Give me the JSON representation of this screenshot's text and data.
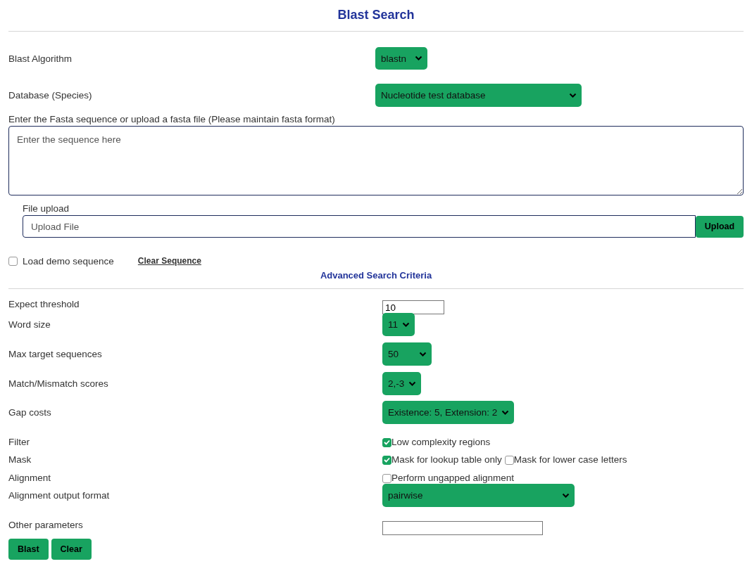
{
  "title": "Blast Search",
  "top_rows": [
    {
      "label": "Blast Algorithm",
      "value": "blastn"
    },
    {
      "label": "Database (Species)",
      "value": "Nucleotide test database"
    }
  ],
  "sequence": {
    "label": "Enter the Fasta sequence or upload a fasta file (Please maintain fasta format)",
    "placeholder": "Enter the sequence here"
  },
  "file_upload": {
    "label": "File upload",
    "placeholder": "Upload File",
    "button": "Upload"
  },
  "demo": {
    "label": "Load demo sequence",
    "checked": false
  },
  "clear_sequence": "Clear Sequence",
  "advanced_title": "Advanced Search Criteria",
  "advanced_rows": [
    {
      "label": "Expect threshold",
      "kind": "text",
      "value": "10"
    },
    {
      "label": "Word size",
      "kind": "select",
      "value": "11"
    },
    {
      "label": "Max target sequences",
      "kind": "select",
      "value": "50"
    },
    {
      "label": "Match/Mismatch scores",
      "kind": "select",
      "value": "2,-3"
    },
    {
      "label": "Gap costs",
      "kind": "select",
      "value": "Existence: 5, Extension: 2"
    },
    {
      "label": "Filter",
      "kind": "checks",
      "options": [
        {
          "label": "Low complexity regions",
          "checked": true
        }
      ]
    },
    {
      "label": "Mask",
      "kind": "checks",
      "options": [
        {
          "label": "Mask for lookup table only",
          "checked": true
        },
        {
          "label": "Mask for lower case letters",
          "checked": false
        }
      ]
    },
    {
      "label": "Alignment",
      "kind": "checks",
      "options": [
        {
          "label": "Perform ungapped alignment",
          "checked": false
        }
      ]
    },
    {
      "label": "Alignment output format",
      "kind": "select",
      "value": "pairwise"
    },
    {
      "label": "Other parameters",
      "kind": "text"
    }
  ],
  "buttons": [
    "Blast",
    "Clear"
  ]
}
